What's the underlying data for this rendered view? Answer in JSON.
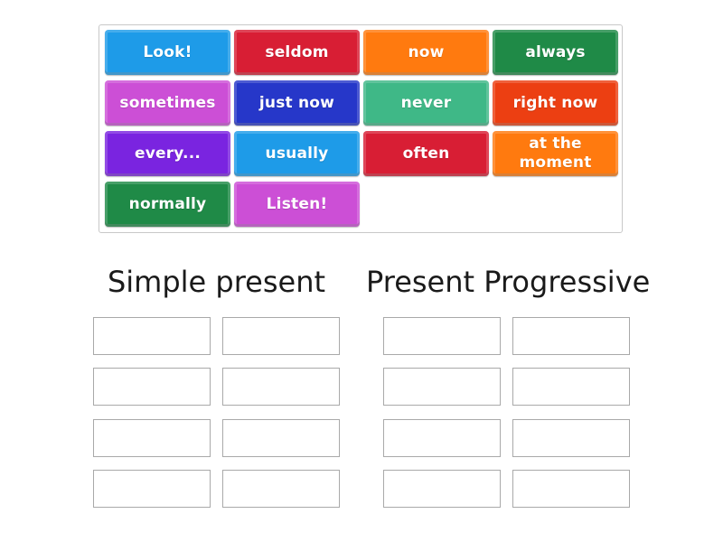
{
  "activity": {
    "type": "group-sort",
    "tiles": [
      {
        "label": "Look!",
        "color": "#1e9be8"
      },
      {
        "label": "seldom",
        "color": "#d81e34"
      },
      {
        "label": "now",
        "color": "#ff7a0f"
      },
      {
        "label": "always",
        "color": "#1f8a47"
      },
      {
        "label": "sometimes",
        "color": "#cc4fd6"
      },
      {
        "label": "just now",
        "color": "#2637c9"
      },
      {
        "label": "never",
        "color": "#3fb887"
      },
      {
        "label": "right now",
        "color": "#ec3f12"
      },
      {
        "label": "every...",
        "color": "#7a24e0"
      },
      {
        "label": "usually",
        "color": "#1e9be8"
      },
      {
        "label": "often",
        "color": "#d81e34"
      },
      {
        "label": "at the moment",
        "color": "#ff7a0f"
      },
      {
        "label": "normally",
        "color": "#1f8a47"
      },
      {
        "label": "Listen!",
        "color": "#cc4fd6"
      }
    ],
    "groups": [
      {
        "title": "Simple present",
        "slots": 8
      },
      {
        "title": "Present Progressive",
        "slots": 8
      }
    ]
  }
}
